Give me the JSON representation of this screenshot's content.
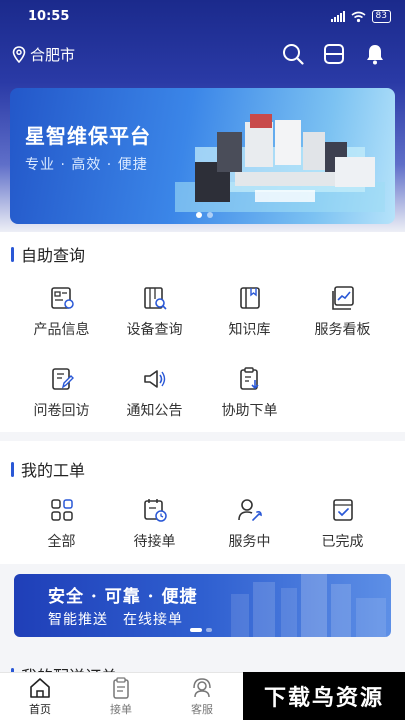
{
  "status": {
    "time": "10:55",
    "battery": "83"
  },
  "header": {
    "location": "合肥市"
  },
  "banner": {
    "title": "星智维保平台",
    "subtitle": "专业 · 高效 · 便捷"
  },
  "self_service": {
    "title": "自助查询",
    "items": [
      {
        "label": "产品信息",
        "icon": "product-info-icon"
      },
      {
        "label": "设备查询",
        "icon": "device-search-icon"
      },
      {
        "label": "知识库",
        "icon": "knowledge-book-icon"
      },
      {
        "label": "服务看板",
        "icon": "dashboard-chart-icon"
      },
      {
        "label": "问卷回访",
        "icon": "survey-edit-icon"
      },
      {
        "label": "通知公告",
        "icon": "megaphone-icon"
      },
      {
        "label": "协助下单",
        "icon": "assist-order-icon"
      }
    ]
  },
  "my_orders": {
    "title": "我的工单",
    "items": [
      {
        "label": "全部",
        "icon": "grid-all-icon"
      },
      {
        "label": "待接单",
        "icon": "pending-calendar-icon"
      },
      {
        "label": "服务中",
        "icon": "user-wrench-icon"
      },
      {
        "label": "已完成",
        "icon": "completed-check-icon"
      }
    ]
  },
  "promo": {
    "title": "安全 · 可靠 · 便捷",
    "subtitle": "智能推送　在线接单"
  },
  "next_section": {
    "title": "我的配送订单"
  },
  "tabbar": [
    {
      "label": "首页",
      "icon": "home-icon",
      "active": true
    },
    {
      "label": "接单",
      "icon": "clipboard-icon",
      "active": false
    },
    {
      "label": "客服",
      "icon": "headset-icon",
      "active": false
    }
  ],
  "watermark": "下载鸟资源",
  "colors": {
    "accent": "#2a58d6",
    "header": "#1b2a8c"
  }
}
